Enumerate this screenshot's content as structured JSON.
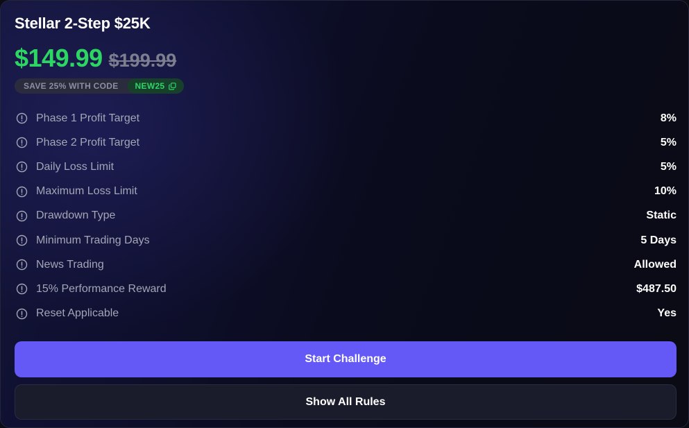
{
  "plan": {
    "title": "Stellar 2-Step $25K",
    "price": "$149.99",
    "original_price": "$199.99"
  },
  "promo": {
    "text": "SAVE 25% WITH CODE",
    "code": "NEW25"
  },
  "rules": [
    {
      "label": "Phase 1 Profit Target",
      "value": "8%"
    },
    {
      "label": "Phase 2 Profit Target",
      "value": "5%"
    },
    {
      "label": "Daily Loss Limit",
      "value": "5%"
    },
    {
      "label": "Maximum Loss Limit",
      "value": "10%"
    },
    {
      "label": "Drawdown Type",
      "value": "Static"
    },
    {
      "label": "Minimum Trading Days",
      "value": "5 Days"
    },
    {
      "label": "News Trading",
      "value": "Allowed"
    },
    {
      "label": "15% Performance Reward",
      "value": "$487.50"
    },
    {
      "label": "Reset Applicable",
      "value": "Yes"
    }
  ],
  "actions": {
    "start_label": "Start Challenge",
    "rules_label": "Show All Rules"
  },
  "colors": {
    "accent": "#6458f7",
    "price_green": "#2bd663",
    "code_green": "#2fd468"
  },
  "icons": {
    "rule_icon": "info-circle-icon",
    "copy_icon": "copy-icon"
  }
}
